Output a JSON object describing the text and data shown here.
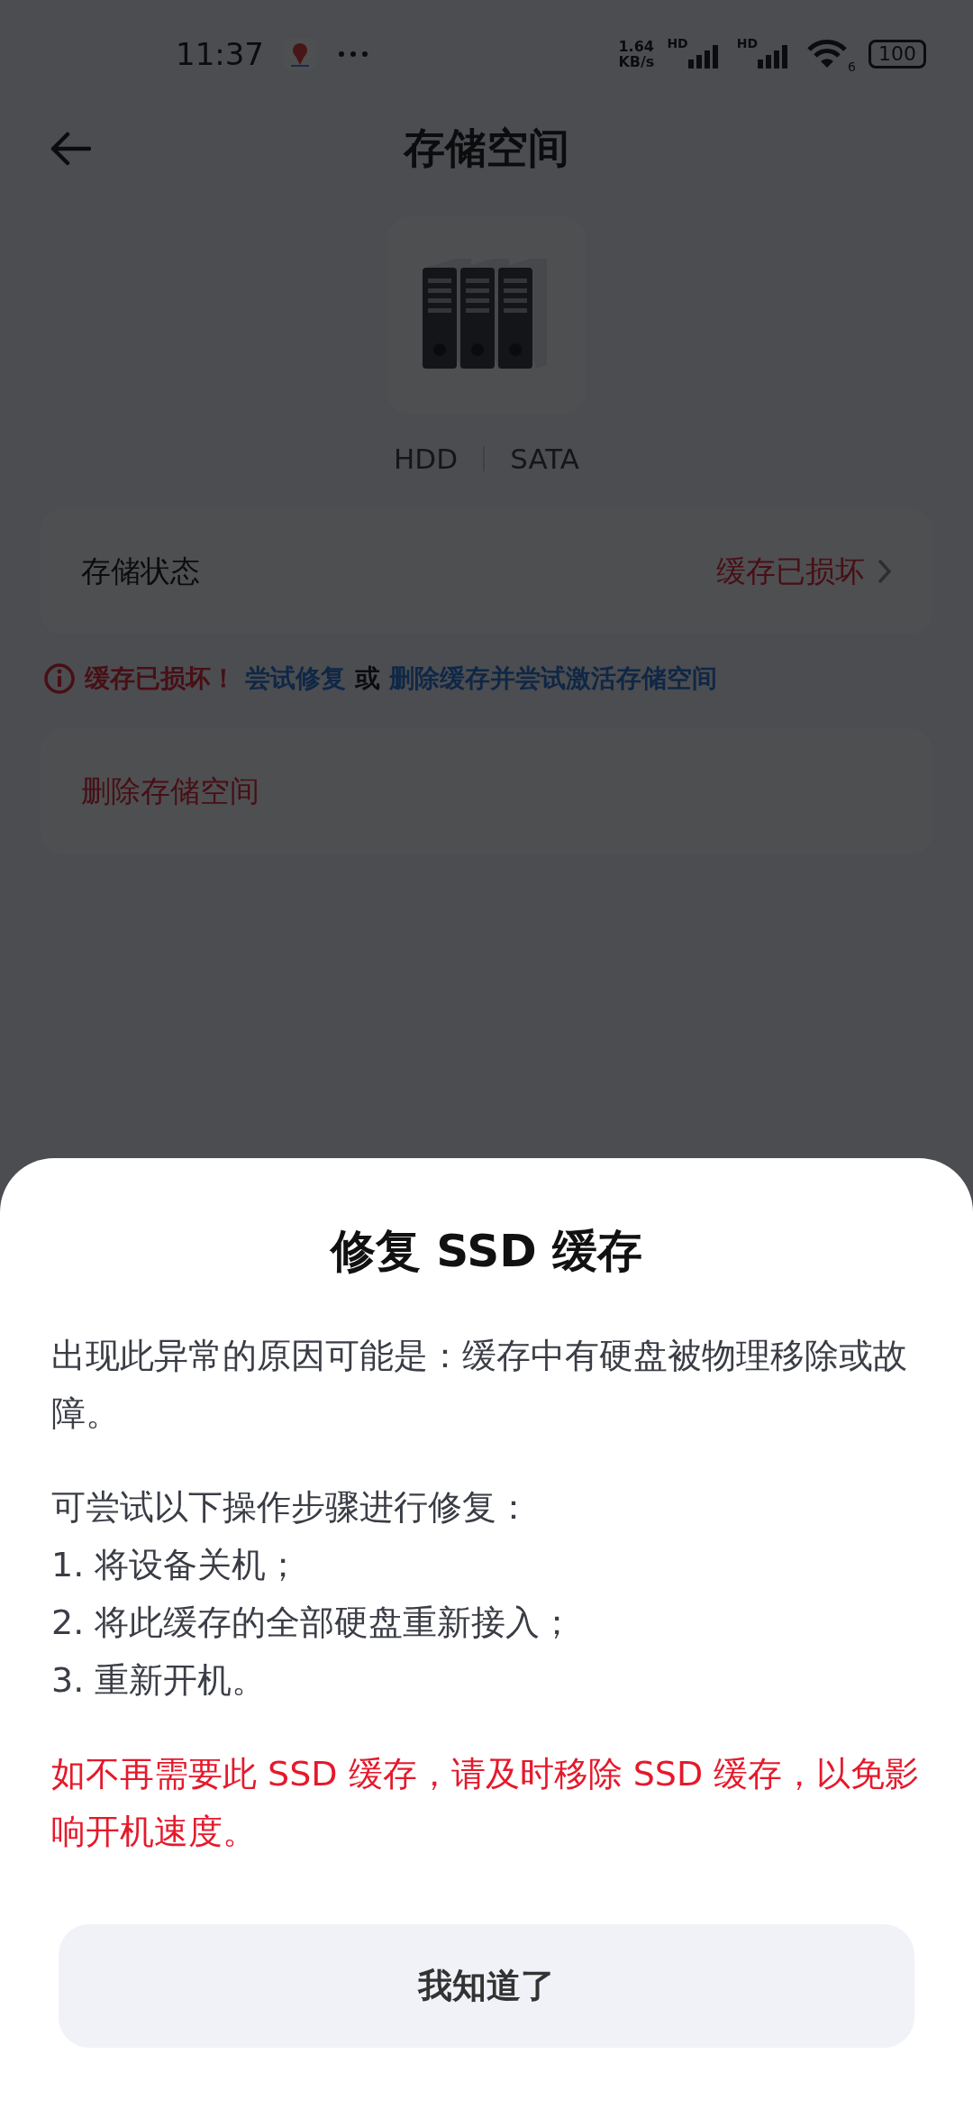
{
  "status_bar": {
    "time": "11:37",
    "network_speed": [
      "1.64",
      "KB/s"
    ],
    "sim_signals": [
      {
        "label": "HD"
      },
      {
        "label": "HD"
      }
    ],
    "wifi_label": "6",
    "battery": "100"
  },
  "header": {
    "title": "存储空间"
  },
  "device": {
    "tags": [
      "HDD",
      "SATA"
    ]
  },
  "status_row": {
    "label": "存储状态",
    "value": "缓存已损坏"
  },
  "warning": {
    "text": "缓存已损坏！",
    "link_1": "尝试修复",
    "separator": "或",
    "link_2": "删除缓存并尝试激活存储空间"
  },
  "delete_row": {
    "label": "删除存储空间"
  },
  "sheet": {
    "title": "修复 SSD 缓存",
    "paragraphs": [
      {
        "kind": "normal",
        "lines": [
          "出现此异常的原因可能是：缓存中有硬盘被物理移除或故障。"
        ]
      },
      {
        "kind": "normal",
        "lines": [
          "可尝试以下操作步骤进行修复：",
          "1. 将设备关机；",
          "2. 将此缓存的全部硬盘重新接入；",
          "3. 重新开机。"
        ]
      },
      {
        "kind": "warning",
        "lines": [
          "如不再需要此 SSD 缓存，请及时移除 SSD 缓存，以免影响开机速度。"
        ]
      }
    ],
    "button": "我知道了"
  }
}
